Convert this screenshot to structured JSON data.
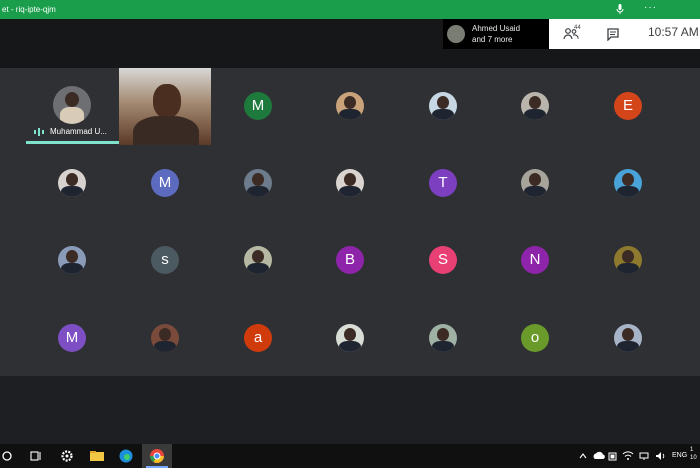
{
  "window": {
    "title": "et - riq-ipte-qjm"
  },
  "header": {
    "presenter_name": "Ahmed Usaid",
    "presenter_more": "and 7 more",
    "participant_count": "44",
    "time": "10:57 AM"
  },
  "speaker": {
    "name": "Muhammad U..."
  },
  "participants": [
    {
      "row": 0,
      "col": 2,
      "kind": "letter",
      "letter": "M",
      "color": "#1e7a3c"
    },
    {
      "row": 0,
      "col": 3,
      "kind": "photo",
      "color": "#c9a27a"
    },
    {
      "row": 0,
      "col": 4,
      "kind": "photo",
      "color": "#c7d8e4"
    },
    {
      "row": 0,
      "col": 5,
      "kind": "photo",
      "color": "#b9b5ad"
    },
    {
      "row": 0,
      "col": 6,
      "kind": "letter",
      "letter": "E",
      "color": "#d4451a"
    },
    {
      "row": 1,
      "col": 0,
      "kind": "photo",
      "color": "#d7d2cf"
    },
    {
      "row": 1,
      "col": 1,
      "kind": "letter",
      "letter": "M",
      "color": "#5c6bc0"
    },
    {
      "row": 1,
      "col": 2,
      "kind": "photo",
      "color": "#6d7c8c"
    },
    {
      "row": 1,
      "col": 3,
      "kind": "photo",
      "color": "#d9d4cf"
    },
    {
      "row": 1,
      "col": 4,
      "kind": "letter",
      "letter": "T",
      "color": "#7b3fbf"
    },
    {
      "row": 1,
      "col": 5,
      "kind": "photo",
      "color": "#a7a49c"
    },
    {
      "row": 1,
      "col": 6,
      "kind": "photo",
      "color": "#4aa3d8"
    },
    {
      "row": 2,
      "col": 0,
      "kind": "photo",
      "color": "#8a9bb8"
    },
    {
      "row": 2,
      "col": 1,
      "kind": "letter",
      "letter": "s",
      "color": "#4b5961"
    },
    {
      "row": 2,
      "col": 2,
      "kind": "photo",
      "color": "#b6b8a4"
    },
    {
      "row": 2,
      "col": 3,
      "kind": "letter",
      "letter": "B",
      "color": "#8e24aa"
    },
    {
      "row": 2,
      "col": 4,
      "kind": "letter",
      "letter": "S",
      "color": "#e84075"
    },
    {
      "row": 2,
      "col": 5,
      "kind": "letter",
      "letter": "N",
      "color": "#8e24aa"
    },
    {
      "row": 2,
      "col": 6,
      "kind": "photo",
      "color": "#8d7a2e"
    },
    {
      "row": 3,
      "col": 0,
      "kind": "letter",
      "letter": "M",
      "color": "#7e4fc4"
    },
    {
      "row": 3,
      "col": 1,
      "kind": "photo",
      "color": "#7a4a3b"
    },
    {
      "row": 3,
      "col": 2,
      "kind": "letter",
      "letter": "a",
      "color": "#d03b0c"
    },
    {
      "row": 3,
      "col": 3,
      "kind": "photo",
      "color": "#d8ddd6"
    },
    {
      "row": 3,
      "col": 4,
      "kind": "photo",
      "color": "#9fb0a4"
    },
    {
      "row": 3,
      "col": 5,
      "kind": "letter",
      "letter": "o",
      "color": "#6a9b2a"
    },
    {
      "row": 3,
      "col": 6,
      "kind": "photo",
      "color": "#a7b4c8"
    }
  ],
  "tray": {
    "lang": "ENG",
    "time": "1",
    "date": "10"
  },
  "colors": {
    "titlebar": "#1a9e4b",
    "grid": "#2f3033",
    "speaker_accent": "#7ee2cc"
  }
}
